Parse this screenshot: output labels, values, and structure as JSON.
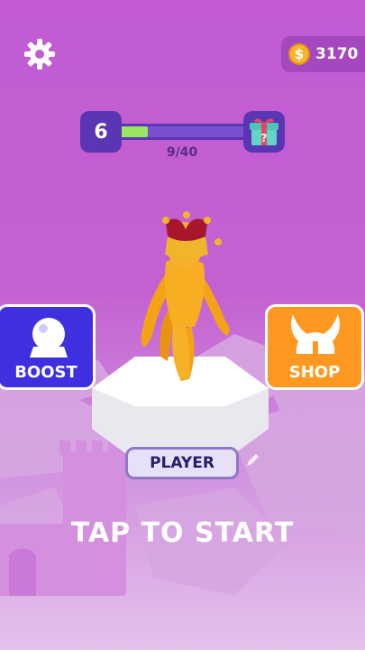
{
  "hud": {
    "coins": "3170",
    "coin_symbol": "$",
    "level": "6",
    "progress_text": "9/40",
    "progress_fraction": 0.225
  },
  "buttons": {
    "boost_label": "BOOST",
    "shop_label": "SHOP",
    "player_label": "PLAYER"
  },
  "prompt": {
    "tap_to_start": "TAP TO START"
  },
  "colors": {
    "background": "#c25bd2",
    "boost": "#3e2fe0",
    "shop": "#ff9820",
    "progress_fill": "#9be65f",
    "character": "#f4a216",
    "crown": "#f0b52b"
  },
  "icons": [
    "gear-icon",
    "coin-icon",
    "gift-icon",
    "crystal-ball-icon",
    "horned-helmet-icon",
    "pencil-icon"
  ]
}
